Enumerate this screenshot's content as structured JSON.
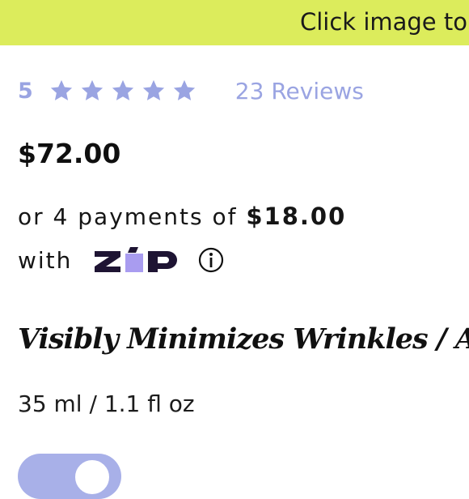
{
  "banner": {
    "text": "Click image to"
  },
  "rating": {
    "value": "5",
    "stars_filled": 5,
    "stars_total": 5,
    "reviews_label": "23 Reviews",
    "color": "#9aa4e2"
  },
  "price": "$72.00",
  "installments": {
    "prefix": "or 4 payments of",
    "amount": "$18.00",
    "with_label": "with",
    "provider_logo_text": "ZIP",
    "info_icon": "info-circle-icon"
  },
  "tagline": "Visibly Minimizes Wrinkles / A",
  "size": "35 ml / 1.1 fl oz",
  "colors": {
    "banner": "#dcec5c",
    "accent": "#9aa4e2",
    "zip_dark": "#1e1433",
    "zip_purple": "#a99cf0"
  }
}
